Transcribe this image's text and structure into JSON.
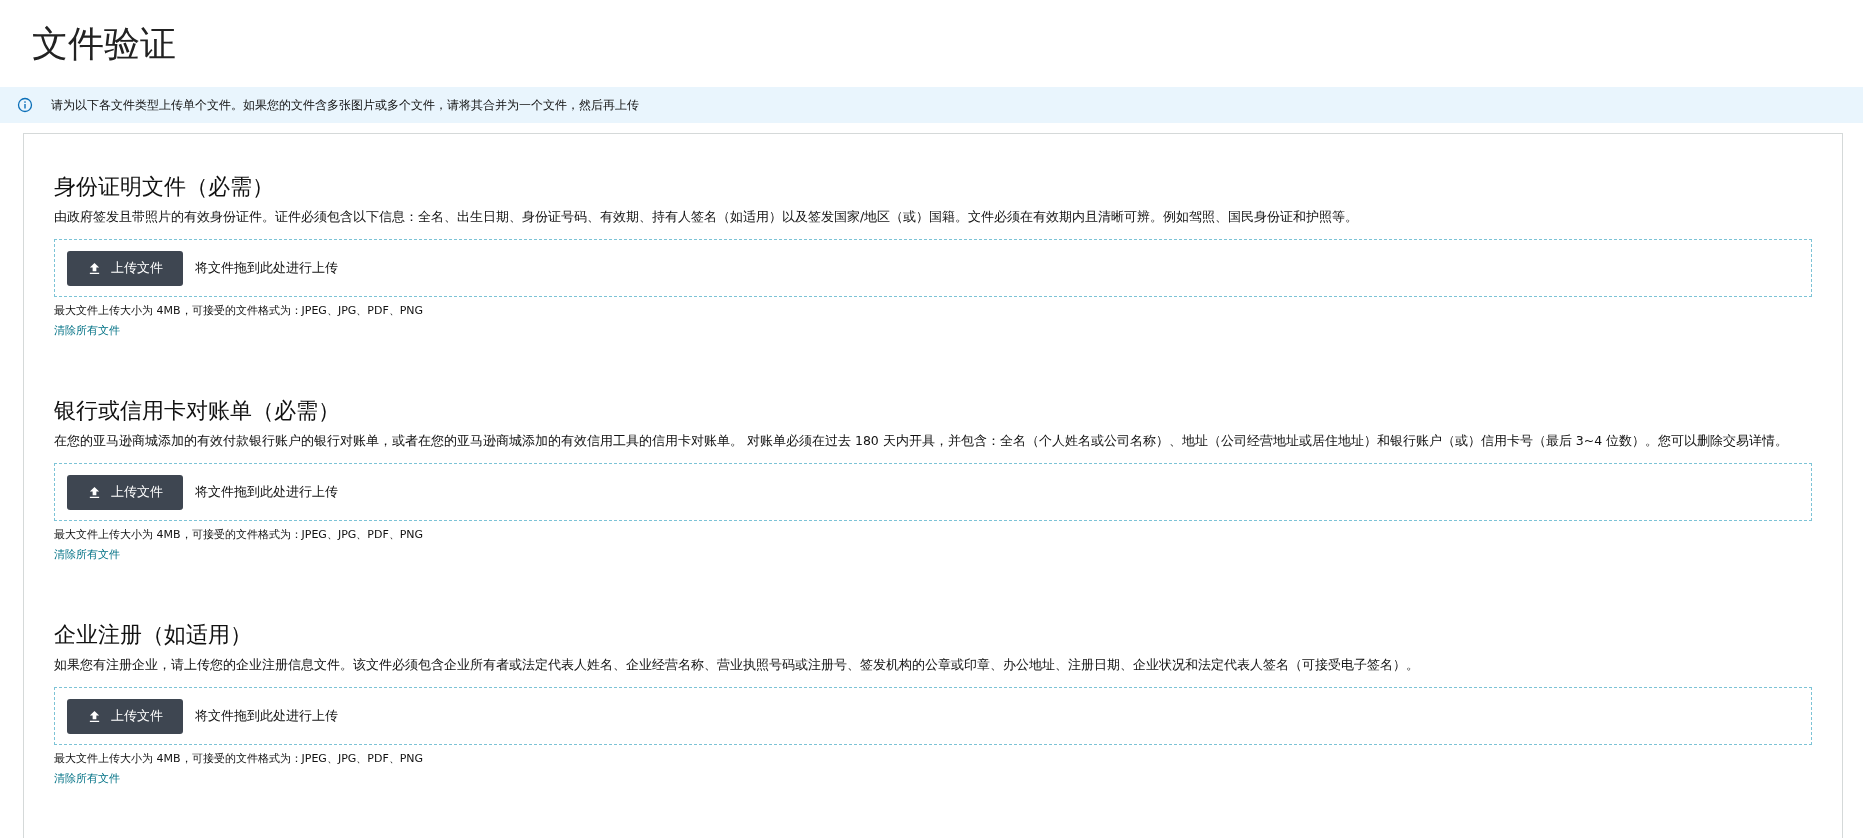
{
  "title": "文件验证",
  "notice": "请为以下各文件类型上传单个文件。如果您的文件含多张图片或多个文件，请将其合并为一个文件，然后再上传",
  "sections": [
    {
      "heading": "身份证明文件（必需）",
      "description": "由政府签发且带照片的有效身份证件。证件必须包含以下信息：全名、出生日期、身份证号码、有效期、持有人签名（如适用）以及签发国家/地区（或）国籍。文件必须在有效期内且清晰可辨。例如驾照、国民身份证和护照等。",
      "upload_button": "上传文件",
      "drop_hint": "将文件拖到此处进行上传",
      "file_info": "最大文件上传大小为 4MB，可接受的文件格式为：JPEG、JPG、PDF、PNG",
      "clear_link": "清除所有文件"
    },
    {
      "heading": "银行或信用卡对账单（必需）",
      "description": "在您的亚马逊商城添加的有效付款银行账户的银行对账单，或者在您的亚马逊商城添加的有效信用工具的信用卡对账单。 对账单必须在过去 180 天内开具，并包含：全名（个人姓名或公司名称）、地址（公司经营地址或居住地址）和银行账户（或）信用卡号（最后 3~4 位数）。您可以删除交易详情。",
      "upload_button": "上传文件",
      "drop_hint": "将文件拖到此处进行上传",
      "file_info": "最大文件上传大小为 4MB，可接受的文件格式为：JPEG、JPG、PDF、PNG",
      "clear_link": "清除所有文件"
    },
    {
      "heading": "企业注册（如适用）",
      "description": "如果您有注册企业，请上传您的企业注册信息文件。该文件必须包含企业所有者或法定代表人姓名、企业经营名称、营业执照号码或注册号、签发机构的公章或印章、办公地址、注册日期、企业状况和法定代表人签名（可接受电子签名）。",
      "upload_button": "上传文件",
      "drop_hint": "将文件拖到此处进行上传",
      "file_info": "最大文件上传大小为 4MB，可接受的文件格式为：JPEG、JPG、PDF、PNG",
      "clear_link": "清除所有文件"
    }
  ]
}
